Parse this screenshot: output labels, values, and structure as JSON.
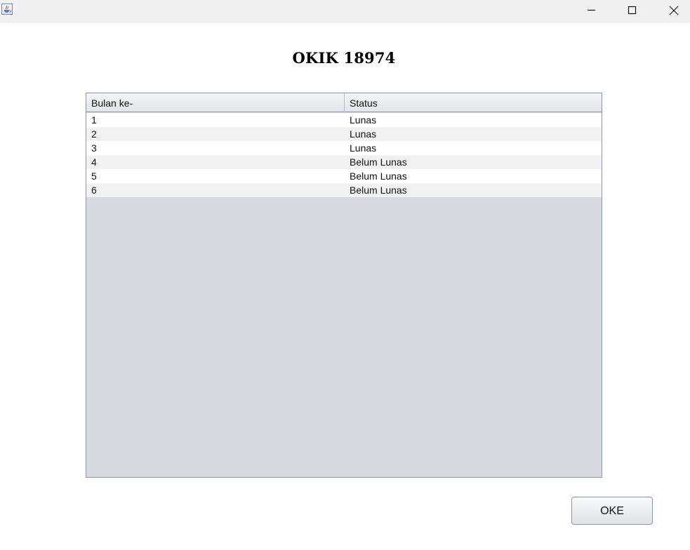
{
  "window": {
    "controls": [
      "minimize-icon",
      "maximize-icon",
      "close-icon"
    ],
    "app_icon": "java-cup-icon"
  },
  "dialog": {
    "title": "OKIK 18974"
  },
  "table": {
    "columns": [
      "Bulan ke-",
      "Status"
    ],
    "rows": [
      [
        "1",
        "Lunas"
      ],
      [
        "2",
        "Lunas"
      ],
      [
        "3",
        "Lunas"
      ],
      [
        "4",
        "Belum Lunas"
      ],
      [
        "5",
        "Belum Lunas"
      ],
      [
        "6",
        "Belum Lunas"
      ]
    ]
  },
  "buttons": {
    "ok_label": "OKE"
  },
  "colors": {
    "titlebar": "#f0f0f0",
    "table_empty_area": "#d6d9e0",
    "row_alt": "#f1f1f1"
  }
}
